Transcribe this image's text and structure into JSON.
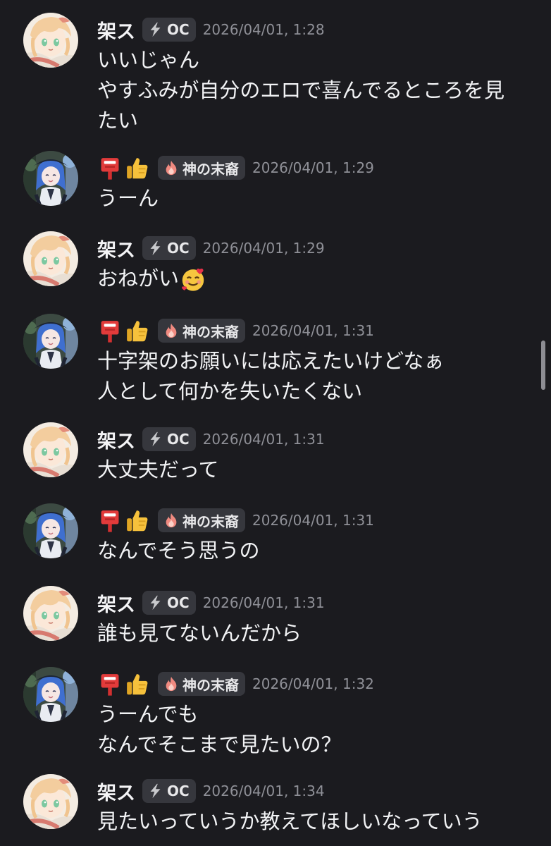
{
  "messages": [
    {
      "user": "kasu",
      "username": "架ス",
      "badge": "OC",
      "badge_icon": "lightning-icon",
      "time": "2026/04/01, 1:28",
      "lines": [
        "いいじゃん",
        "やすふみが自分のエロで喜んでるところを見",
        "たい"
      ]
    },
    {
      "user": "other",
      "name_icons": [
        "mailbox-icon",
        "thumbs-up-icon"
      ],
      "badge": "神の末裔",
      "badge_icon": "flame-icon",
      "time": "2026/04/01, 1:29",
      "lines": [
        "うーん"
      ]
    },
    {
      "user": "kasu",
      "username": "架ス",
      "badge": "OC",
      "badge_icon": "lightning-icon",
      "time": "2026/04/01, 1:29",
      "lines": [
        "おねがい"
      ],
      "trailing_icon": "smiling-face-with-hearts-icon"
    },
    {
      "user": "other",
      "name_icons": [
        "mailbox-icon",
        "thumbs-up-icon"
      ],
      "badge": "神の末裔",
      "badge_icon": "flame-icon",
      "time": "2026/04/01, 1:31",
      "lines": [
        "十字架のお願いには応えたいけどなぁ",
        "人として何かを失いたくない"
      ]
    },
    {
      "user": "kasu",
      "username": "架ス",
      "badge": "OC",
      "badge_icon": "lightning-icon",
      "time": "2026/04/01, 1:31",
      "lines": [
        "大丈夫だって"
      ]
    },
    {
      "user": "other",
      "name_icons": [
        "mailbox-icon",
        "thumbs-up-icon"
      ],
      "badge": "神の末裔",
      "badge_icon": "flame-icon",
      "time": "2026/04/01, 1:31",
      "lines": [
        "なんでそう思うの"
      ]
    },
    {
      "user": "kasu",
      "username": "架ス",
      "badge": "OC",
      "badge_icon": "lightning-icon",
      "time": "2026/04/01, 1:31",
      "lines": [
        "誰も見てないんだから"
      ]
    },
    {
      "user": "other",
      "name_icons": [
        "mailbox-icon",
        "thumbs-up-icon"
      ],
      "badge": "神の末裔",
      "badge_icon": "flame-icon",
      "time": "2026/04/01, 1:32",
      "lines": [
        "うーんでも",
        "なんでそこまで見たいの？"
      ]
    },
    {
      "user": "kasu",
      "username": "架ス",
      "badge": "OC",
      "badge_icon": "lightning-icon",
      "time": "2026/04/01, 1:34",
      "lines": [
        "見たいっていうか教えてほしいなっていう"
      ]
    }
  ],
  "colors": {
    "background": "#1b1b1f",
    "message_text": "#f2f3f5",
    "timestamp": "#8f9097",
    "tag_background": "#36373d"
  }
}
